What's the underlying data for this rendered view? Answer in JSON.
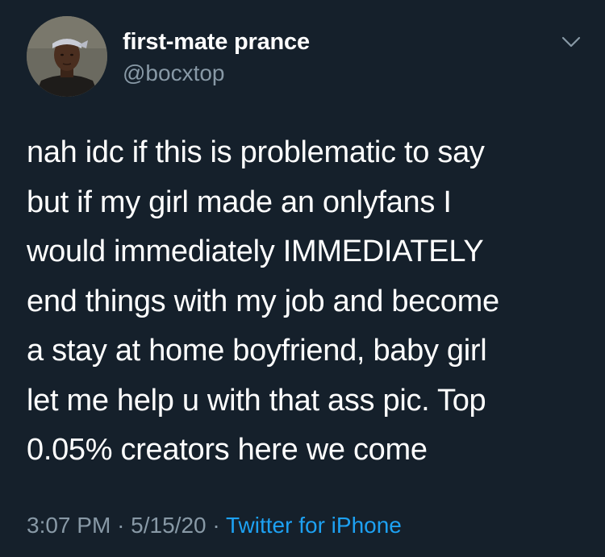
{
  "author": {
    "display_name": "first-mate prance",
    "handle": "@bocxtop",
    "avatar_icon": "profile-photo"
  },
  "tweet": {
    "lines": [
      "nah idc if this is problematic to say",
      "but if my girl made an onlyfans I",
      "would immediately IMMEDIATELY",
      "end things with my job and become",
      "a stay at home boyfriend, baby girl",
      "let me help u with that ass pic. Top",
      "0.05% creators here we come"
    ]
  },
  "meta": {
    "time": "3:07 PM",
    "separator": "·",
    "date": "5/15/20",
    "source": "Twitter for iPhone"
  },
  "menu": {
    "icon": "chevron-down-icon"
  },
  "colors": {
    "background": "#15202b",
    "text": "#ffffff",
    "secondary": "#8899a6",
    "link": "#1da1f2"
  }
}
